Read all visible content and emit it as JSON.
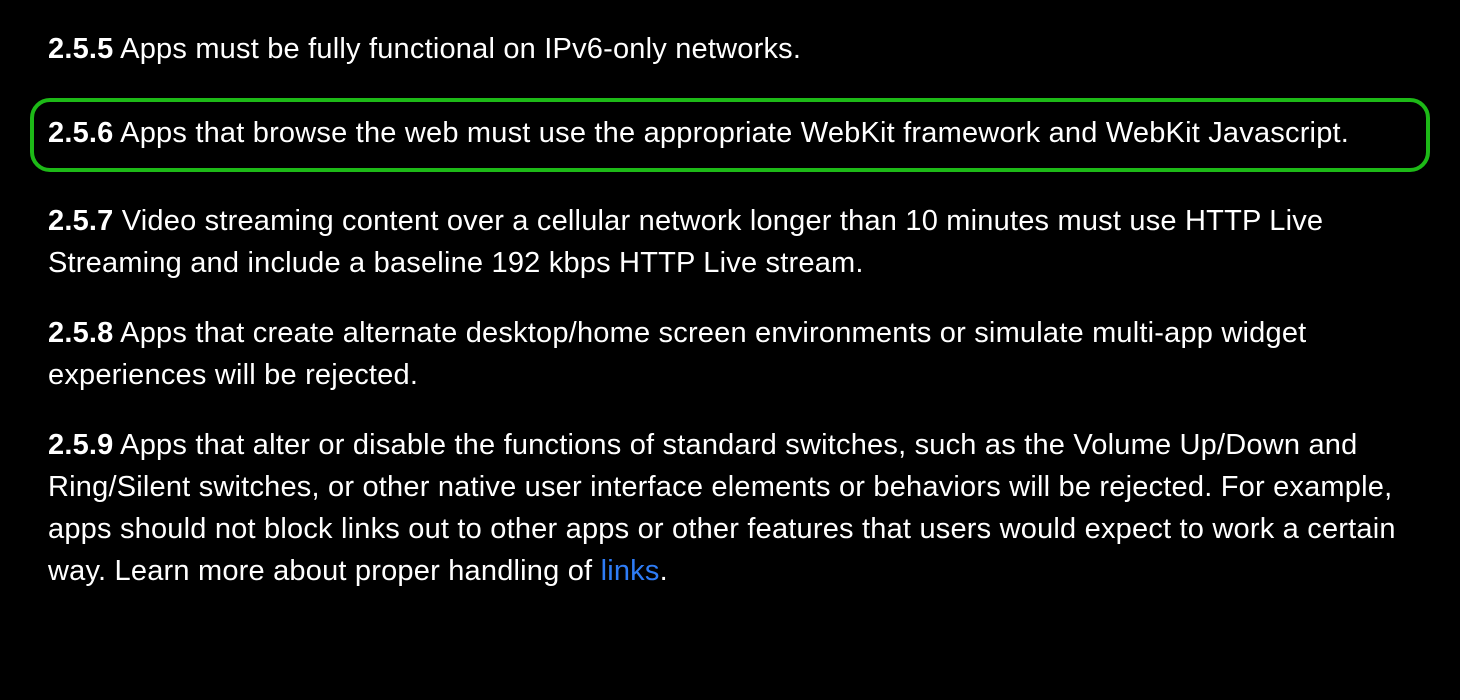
{
  "rules": {
    "r255": {
      "num": "2.5.5",
      "text": " Apps must be fully functional on IPv6-only networks."
    },
    "r256": {
      "num": "2.5.6",
      "text": " Apps that browse the web must use the appropriate WebKit framework and WebKit Javascript."
    },
    "r257": {
      "num": "2.5.7",
      "text": " Video streaming content over a cellular network longer than 10 minutes must use HTTP Live Streaming and include a baseline 192 kbps HTTP Live stream."
    },
    "r258": {
      "num": "2.5.8",
      "text": " Apps that create alternate desktop/home screen environments or simulate multi-app widget experiences will be rejected."
    },
    "r259": {
      "num": "2.5.9",
      "text_a": " Apps that alter or disable the functions of standard switches, such as the Volume Up/Down and Ring/Silent switches, or other native user interface elements or behaviors will be rejected. For example, apps should not block links out to other apps or other features that users would expect to work a certain way. Learn more about proper handling of ",
      "link": "links",
      "text_b": "."
    }
  }
}
